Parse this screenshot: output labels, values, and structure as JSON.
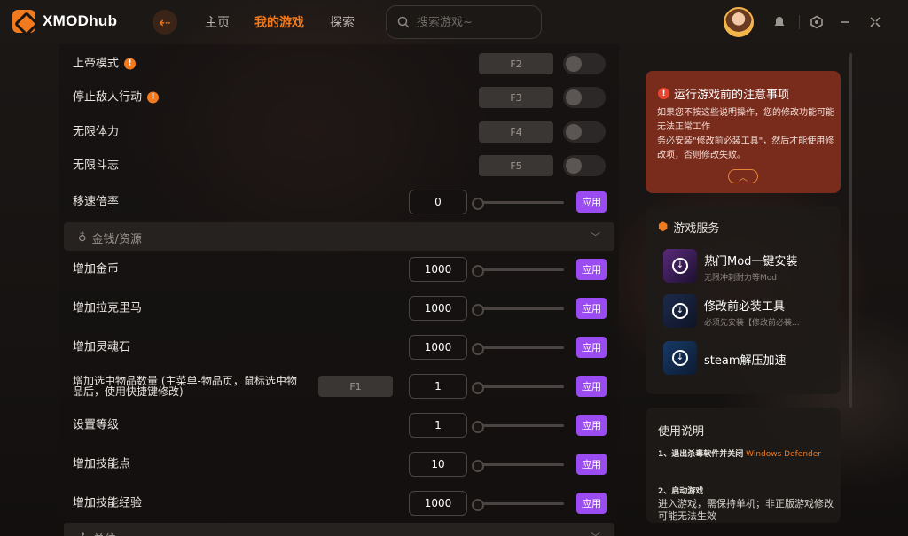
{
  "app": {
    "name": "XMODhub"
  },
  "nav": {
    "home": "主页",
    "mine": "我的游戏",
    "explore": "探索"
  },
  "search": {
    "placeholder": "搜索游戏~"
  },
  "cheats": [
    {
      "label": "上帝模式",
      "info": true,
      "hotkey": "F2",
      "type": "toggle",
      "on": false
    },
    {
      "label": "停止敌人行动",
      "info": true,
      "hotkey": "F3",
      "type": "toggle",
      "on": false
    },
    {
      "label": "无限体力",
      "info": false,
      "hotkey": "F4",
      "type": "toggle",
      "on": false
    },
    {
      "label": "无限斗志",
      "info": false,
      "hotkey": "F5",
      "type": "toggle",
      "on": false
    },
    {
      "label": "移速倍率",
      "value": "0",
      "type": "slider"
    }
  ],
  "section_money": {
    "title": "金钱/资源"
  },
  "resources": [
    {
      "label": "增加金币",
      "value": "1000"
    },
    {
      "label": "增加拉克里马",
      "value": "1000"
    },
    {
      "label": "增加灵魂石",
      "value": "1000"
    },
    {
      "label_line1": "增加选中物品数量 (主菜单-物品页，鼠标选中物",
      "label_line2": "品后，使用快捷键修改)",
      "hotkey": "F1",
      "value": "1"
    },
    {
      "label": "设置等级",
      "value": "1"
    },
    {
      "label": "增加技能点",
      "value": "10"
    },
    {
      "label": "增加技能经验",
      "value": "1000"
    }
  ],
  "section_units": {
    "title": "单位"
  },
  "apply_label": "应用",
  "notice": {
    "title": "运行游戏前的注意事项",
    "line1": "如果您不按这些说明操作，您的修改功能可能无法正常工作",
    "line2": "务必安装\"修改前必装工具\"，然后才能使用修改项，否则修改失败。"
  },
  "services": {
    "title": "游戏服务",
    "items": [
      {
        "name": "热门Mod一键安装",
        "sub": "无限冲刺耐力等Mod"
      },
      {
        "name": "修改前必装工具",
        "sub": "必须先安装【修改前必装..."
      },
      {
        "name": "steam解压加速",
        "sub": ""
      }
    ]
  },
  "usage": {
    "title": "使用说明",
    "step1_bold": "1、退出杀毒软件并关闭",
    "step1_hl": "Windows Defender",
    "step2_bold": "2、启动游戏",
    "step2_text": "进入游戏，需保持单机；非正版游戏修改可能无法生效"
  },
  "colors": {
    "accent": "#f07a1d",
    "apply": "#9b4bf2",
    "notice_bg": "#7a2c1c"
  },
  "icons": [
    "logo-icon",
    "back-arrow-icon",
    "search-icon",
    "bell-icon",
    "settings-icon",
    "minimize-icon",
    "collapse-icon",
    "info-icon",
    "warning-icon",
    "chevron-up-icon",
    "chevron-down-icon",
    "coin-icon",
    "box-icon",
    "download-icon"
  ]
}
